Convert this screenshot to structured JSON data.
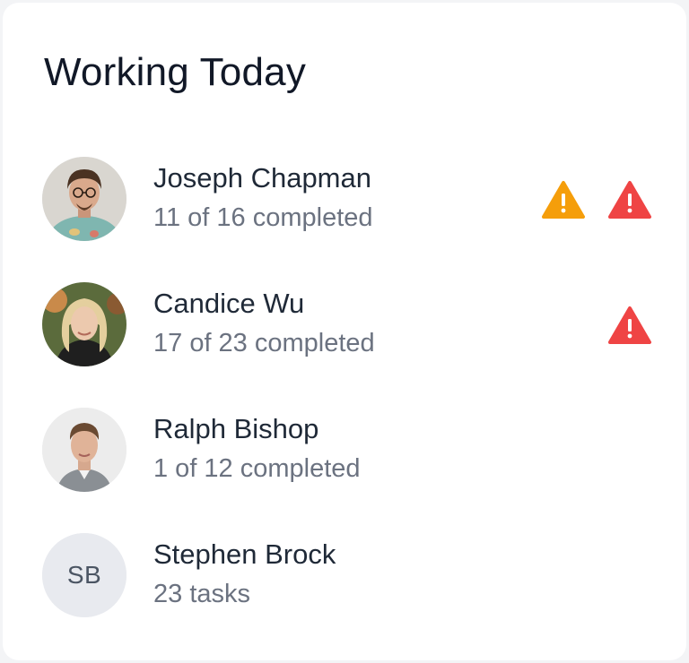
{
  "card": {
    "title": "Working Today"
  },
  "people": [
    {
      "name": "Joseph Chapman",
      "status": "11 of 16 completed",
      "avatar": "photo",
      "alerts": [
        "warning-orange-icon",
        "warning-red-icon"
      ]
    },
    {
      "name": "Candice Wu",
      "status": "17 of 23 completed",
      "avatar": "photo",
      "alerts": [
        "warning-red-icon"
      ]
    },
    {
      "name": "Ralph Bishop",
      "status": "1 of 12 completed",
      "avatar": "photo",
      "alerts": []
    },
    {
      "name": "Stephen Brock",
      "status": "23 tasks",
      "avatar_initials": "SB",
      "alerts": []
    }
  ],
  "colors": {
    "warning_orange": "#f59e0b",
    "warning_red": "#ef4444",
    "initials_bg": "#e8eaef"
  }
}
